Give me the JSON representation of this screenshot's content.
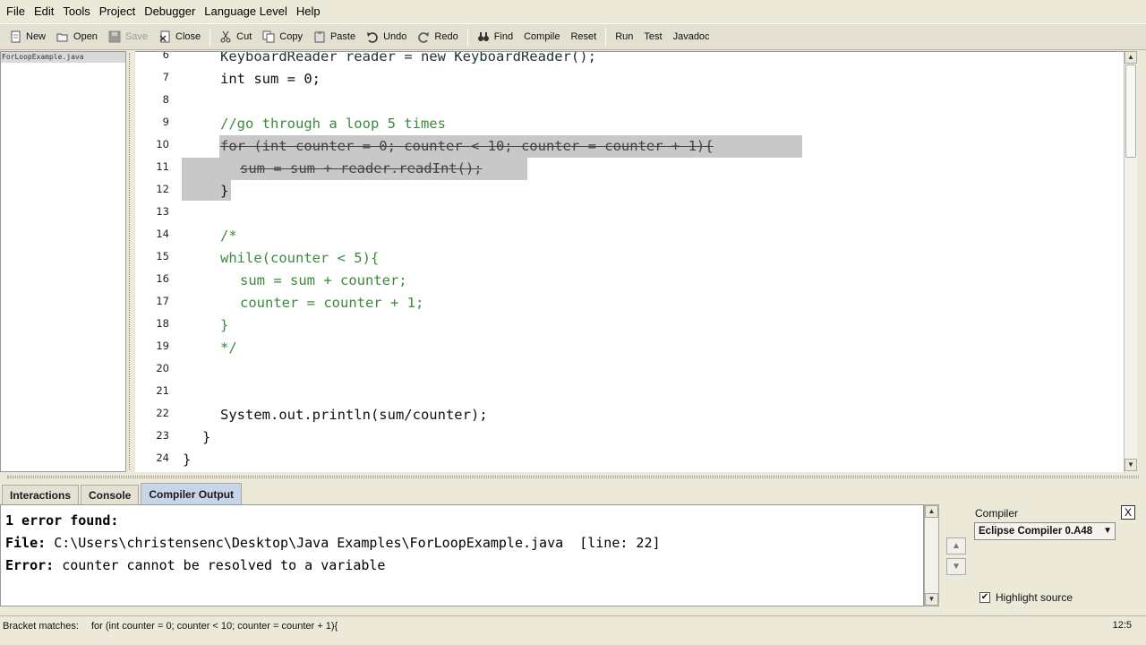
{
  "menu": [
    "File",
    "Edit",
    "Tools",
    "Project",
    "Debugger",
    "Language Level",
    "Help"
  ],
  "toolbar": {
    "new": "New",
    "open": "Open",
    "save": "Save",
    "close": "Close",
    "cut": "Cut",
    "copy": "Copy",
    "paste": "Paste",
    "undo": "Undo",
    "redo": "Redo",
    "find": "Find",
    "compile": "Compile",
    "reset": "Reset",
    "run": "Run",
    "test": "Test",
    "javadoc": "Javadoc"
  },
  "files": [
    "ForLoopExample.java"
  ],
  "editor": {
    "lines": [
      {
        "n": "6",
        "text": "KeyboardReader reader = new KeyboardReader();"
      },
      {
        "n": "7",
        "text": "int sum = 0;"
      },
      {
        "n": "8",
        "text": ""
      },
      {
        "n": "9",
        "text": "//go through a loop 5 times"
      },
      {
        "n": "10",
        "text": "for (int counter = 0; counter < 10; counter = counter + 1){"
      },
      {
        "n": "11",
        "text": "sum = sum + reader.readInt();"
      },
      {
        "n": "12",
        "text": "}"
      },
      {
        "n": "13",
        "text": ""
      },
      {
        "n": "14",
        "text": "/*"
      },
      {
        "n": "15",
        "text": "while(counter < 5){"
      },
      {
        "n": "16",
        "text": "sum = sum + counter;"
      },
      {
        "n": "17",
        "text": "counter = counter + 1;"
      },
      {
        "n": "18",
        "text": "}"
      },
      {
        "n": "19",
        "text": "*/"
      },
      {
        "n": "20",
        "text": ""
      },
      {
        "n": "21",
        "text": ""
      },
      {
        "n": "22",
        "text": "System.out.println(sum/counter);"
      },
      {
        "n": "23",
        "text": "}"
      },
      {
        "n": "24",
        "text": "}"
      }
    ]
  },
  "tabs": [
    "Interactions",
    "Console",
    "Compiler Output"
  ],
  "active_tab": "Compiler Output",
  "output": {
    "summary": "1 error found:",
    "file_label": "File:",
    "file_path": "C:\\Users\\christensenc\\Desktop\\Java Examples\\ForLoopExample.java",
    "line_ref": "[line: 22]",
    "error_label": "Error:",
    "error_msg": "counter cannot be resolved to a variable"
  },
  "compiler": {
    "label": "Compiler",
    "selected": "Eclipse Compiler 0.A48",
    "close": "X",
    "highlight_label": "Highlight source",
    "highlight_checked": true
  },
  "status": {
    "label": "Bracket matches:",
    "text": "for (int counter = 0; counter < 10; counter = counter + 1){",
    "cursor": "12:5"
  }
}
